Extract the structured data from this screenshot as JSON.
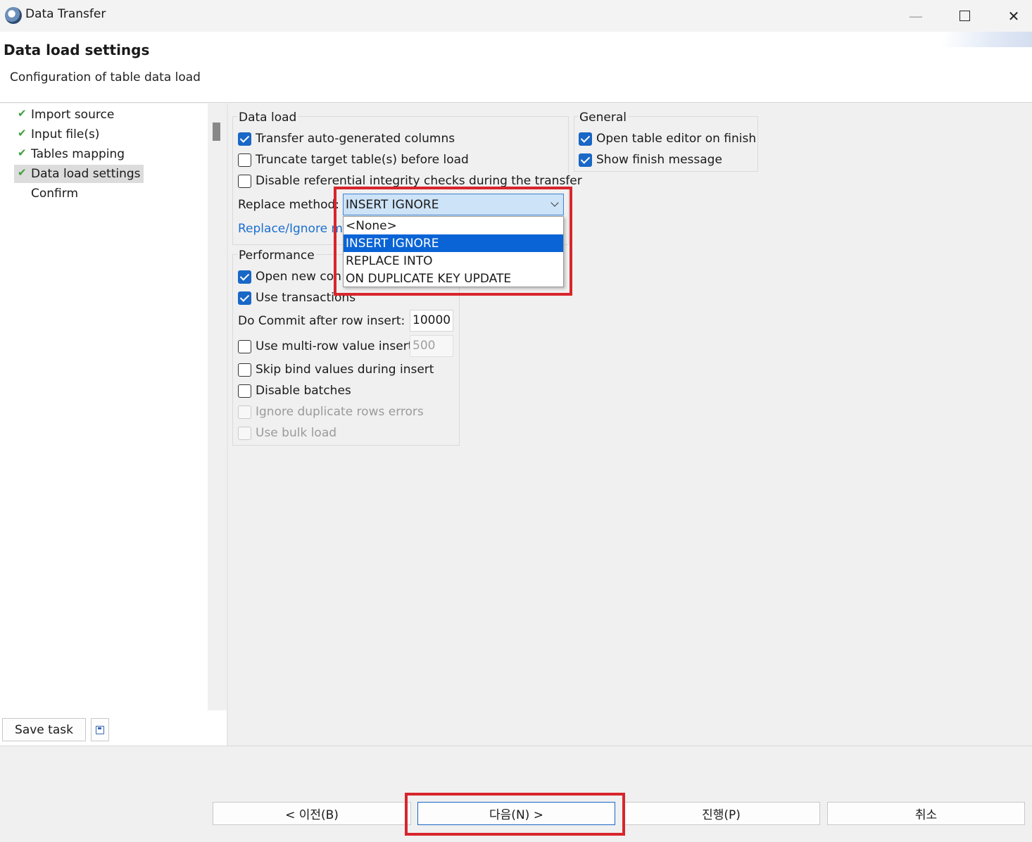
{
  "window": {
    "title": "Data Transfer"
  },
  "header": {
    "title": "Data load settings",
    "subtitle": "Configuration of table data load"
  },
  "nav": {
    "items": [
      {
        "label": "Import source",
        "done": true
      },
      {
        "label": "Input file(s)",
        "done": true
      },
      {
        "label": "Tables mapping",
        "done": true
      },
      {
        "label": "Data load settings",
        "done": true,
        "selected": true
      },
      {
        "label": "Confirm",
        "done": false
      }
    ],
    "save_task_label": "Save task"
  },
  "data_load": {
    "group_label": "Data load",
    "transfer_auto_generated": {
      "label": "Transfer auto-generated columns",
      "checked": true
    },
    "truncate_target": {
      "label": "Truncate target table(s) before load",
      "checked": false
    },
    "disable_ref_integrity": {
      "label": "Disable referential integrity checks during the transfer",
      "checked": false
    },
    "replace_method_label": "Replace method:",
    "replace_method_value": "INSERT IGNORE",
    "replace_method_options": [
      "<None>",
      "INSERT IGNORE",
      "REPLACE INTO",
      "ON DUPLICATE KEY UPDATE"
    ],
    "replace_link_visible": "Replace/Ignore m"
  },
  "general": {
    "group_label": "General",
    "open_table_editor": {
      "label": "Open table editor on finish",
      "checked": true
    },
    "show_finish_message": {
      "label": "Show finish message",
      "checked": true
    }
  },
  "performance": {
    "group_label": "Performance",
    "open_new_connection": {
      "label": "Open new con",
      "checked": true
    },
    "use_transactions": {
      "label": "Use transactions",
      "checked": true
    },
    "commit_label": "Do Commit after row insert:",
    "commit_value": "10000",
    "multi_row": {
      "label": "Use multi-row value insert",
      "checked": false,
      "value": "500"
    },
    "skip_bind": {
      "label": "Skip bind values during insert",
      "checked": false
    },
    "disable_batches": {
      "label": "Disable batches",
      "checked": false
    },
    "ignore_duplicates": {
      "label": "Ignore duplicate rows errors",
      "checked": false,
      "disabled": true
    },
    "use_bulk_load": {
      "label": "Use bulk load",
      "checked": false,
      "disabled": true
    }
  },
  "footer": {
    "back_label": "< 이전(B)",
    "next_label": "다음(N) >",
    "proceed_label": "진행(P)",
    "cancel_label": "취소"
  },
  "colors": {
    "accent": "#1967c6",
    "highlight_box": "#d7262c",
    "selection": "#0a64d6"
  }
}
